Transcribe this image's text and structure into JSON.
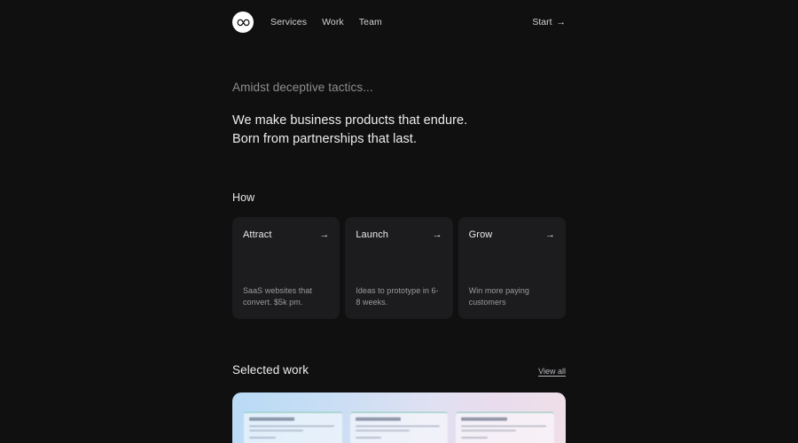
{
  "header": {
    "logo_icon": "infinity-logo-icon",
    "nav": [
      {
        "label": "Services"
      },
      {
        "label": "Work"
      },
      {
        "label": "Team"
      }
    ],
    "cta": {
      "label": "Start",
      "arrow": "→"
    }
  },
  "hero": {
    "eyebrow": "Amidst deceptive tactics...",
    "line1": "We make business products that endure.",
    "line2": "Born from partnerships that last."
  },
  "how": {
    "label": "How",
    "cards": [
      {
        "title": "Attract",
        "desc": "SaaS websites that convert. $5k pm.",
        "arrow": "→"
      },
      {
        "title": "Launch",
        "desc": "Ideas to prototype in 6-8 weeks.",
        "arrow": "→"
      },
      {
        "title": "Grow",
        "desc": "Win more paying customers",
        "arrow": "→"
      }
    ]
  },
  "selected_work": {
    "title": "Selected work",
    "view_all": "View all"
  },
  "colors": {
    "page_background": "#101011",
    "card_background": "#1c1c1e",
    "text_primary": "#ededef",
    "text_muted": "#8e8e92",
    "logo_background": "#ffffff",
    "preview_gradient_start": "#b9daf6",
    "preview_gradient_end": "#efdfe9",
    "mock_accent": "#7fc6ae"
  }
}
